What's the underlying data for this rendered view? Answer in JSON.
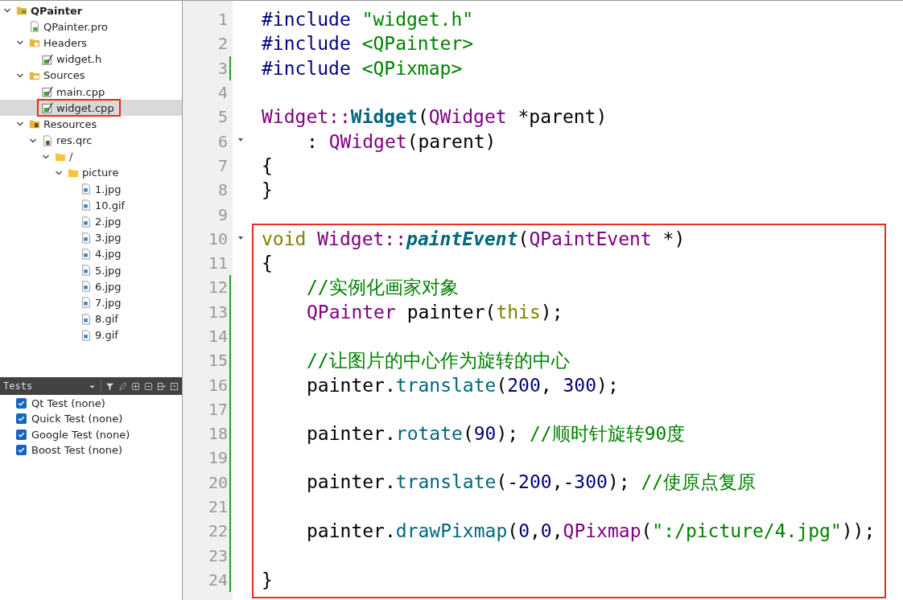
{
  "project_tree": [
    {
      "label": "QPainter",
      "kind": "project",
      "expanded": true,
      "selected": false,
      "boxed": false,
      "children": [
        {
          "label": "QPainter.pro",
          "kind": "pro",
          "selected": false,
          "boxed": false
        },
        {
          "label": "Headers",
          "kind": "headers",
          "expanded": true,
          "selected": false,
          "boxed": false,
          "children": [
            {
              "label": "widget.h",
              "kind": "source",
              "selected": false,
              "boxed": false
            }
          ]
        },
        {
          "label": "Sources",
          "kind": "sources",
          "expanded": true,
          "selected": false,
          "boxed": false,
          "children": [
            {
              "label": "main.cpp",
              "kind": "source",
              "selected": false,
              "boxed": false
            },
            {
              "label": "widget.cpp",
              "kind": "source",
              "selected": true,
              "boxed": true
            }
          ]
        },
        {
          "label": "Resources",
          "kind": "resources",
          "expanded": true,
          "selected": false,
          "boxed": false,
          "children": [
            {
              "label": "res.qrc",
              "kind": "qrc",
              "expanded": true,
              "selected": false,
              "boxed": false,
              "children": [
                {
                  "label": "/",
                  "kind": "folder",
                  "expanded": true,
                  "selected": false,
                  "boxed": false,
                  "children": [
                    {
                      "label": "picture",
                      "kind": "folder",
                      "expanded": true,
                      "selected": false,
                      "boxed": false,
                      "children": [
                        {
                          "label": "1.jpg",
                          "kind": "image",
                          "selected": false,
                          "boxed": false
                        },
                        {
                          "label": "10.gif",
                          "kind": "image",
                          "selected": false,
                          "boxed": false
                        },
                        {
                          "label": "2.jpg",
                          "kind": "image",
                          "selected": false,
                          "boxed": false
                        },
                        {
                          "label": "3.jpg",
                          "kind": "image",
                          "selected": false,
                          "boxed": false
                        },
                        {
                          "label": "4.jpg",
                          "kind": "image",
                          "selected": false,
                          "boxed": false
                        },
                        {
                          "label": "5.jpg",
                          "kind": "image",
                          "selected": false,
                          "boxed": false
                        },
                        {
                          "label": "6.jpg",
                          "kind": "image",
                          "selected": false,
                          "boxed": false
                        },
                        {
                          "label": "7.jpg",
                          "kind": "image",
                          "selected": false,
                          "boxed": false
                        },
                        {
                          "label": "8.gif",
                          "kind": "image",
                          "selected": false,
                          "boxed": false
                        },
                        {
                          "label": "9.gif",
                          "kind": "image",
                          "selected": false,
                          "boxed": false
                        }
                      ]
                    }
                  ]
                }
              ]
            }
          ]
        }
      ]
    }
  ],
  "tests_panel": {
    "title": "Tests",
    "items": [
      {
        "label": "Qt Test (none)",
        "checked": true
      },
      {
        "label": "Quick Test (none)",
        "checked": true
      },
      {
        "label": "Google Test (none)",
        "checked": true
      },
      {
        "label": "Boost Test (none)",
        "checked": true
      }
    ]
  },
  "editor": {
    "lines": [
      {
        "number": "1",
        "changed": false,
        "fold": false,
        "indented": false,
        "tokens": [
          {
            "text": "#include ",
            "kind": "preproc"
          },
          {
            "text": "\"widget.h\"",
            "kind": "string"
          }
        ]
      },
      {
        "number": "2",
        "changed": false,
        "fold": false,
        "indented": false,
        "tokens": [
          {
            "text": "#include ",
            "kind": "preproc"
          },
          {
            "text": "<QPainter>",
            "kind": "string"
          }
        ]
      },
      {
        "number": "3",
        "changed": true,
        "fold": false,
        "indented": false,
        "tokens": [
          {
            "text": "#include ",
            "kind": "preproc"
          },
          {
            "text": "<QPixmap>",
            "kind": "string"
          }
        ]
      },
      {
        "number": "4",
        "changed": false,
        "fold": false
      },
      {
        "number": "5",
        "changed": false,
        "fold": false,
        "indented": false,
        "tokens": [
          {
            "text": "Widget::",
            "kind": "type"
          },
          {
            "text": "Widget",
            "kind": "decl"
          },
          {
            "text": "(",
            "kind": "plain"
          },
          {
            "text": "QWidget",
            "kind": "type"
          },
          {
            "text": " *parent)",
            "kind": "plain"
          }
        ]
      },
      {
        "number": "6",
        "changed": false,
        "fold": true,
        "indented": true,
        "tokens": [
          {
            "text": ": ",
            "kind": "plain"
          },
          {
            "text": "QWidget",
            "kind": "type"
          },
          {
            "text": "(parent)",
            "kind": "plain"
          }
        ]
      },
      {
        "number": "7",
        "changed": false,
        "fold": false,
        "indented": false,
        "tokens": [
          {
            "text": "{",
            "kind": "plain"
          }
        ]
      },
      {
        "number": "8",
        "changed": false,
        "fold": false,
        "indented": false,
        "tokens": [
          {
            "text": "}",
            "kind": "plain"
          }
        ]
      },
      {
        "number": "9",
        "changed": false,
        "fold": false
      }
    ],
    "highlighted_block": {
      "lines": [
        {
          "number": "10",
          "changed": false,
          "fold": true,
          "indented": false,
          "tokens": [
            {
              "text": "void ",
              "kind": "keyword"
            },
            {
              "text": "Widget::",
              "kind": "type"
            },
            {
              "text": "paintEvent",
              "kind": "virtual"
            },
            {
              "text": "(",
              "kind": "plain"
            },
            {
              "text": "QPaintEvent",
              "kind": "type"
            },
            {
              "text": " *)",
              "kind": "plain"
            }
          ]
        },
        {
          "number": "11",
          "changed": false,
          "fold": false,
          "indented": false,
          "tokens": [
            {
              "text": "{",
              "kind": "plain"
            }
          ]
        },
        {
          "number": "12",
          "changed": true,
          "fold": false,
          "indented": true,
          "tokens": [
            {
              "text": "//实例化画家对象",
              "kind": "comment"
            }
          ]
        },
        {
          "number": "13",
          "changed": true,
          "fold": false,
          "indented": true,
          "tokens": [
            {
              "text": "QPainter",
              "kind": "type"
            },
            {
              "text": " painter(",
              "kind": "plain"
            },
            {
              "text": "this",
              "kind": "keyword"
            },
            {
              "text": ");",
              "kind": "plain"
            }
          ]
        },
        {
          "number": "14",
          "changed": true,
          "fold": false
        },
        {
          "number": "15",
          "changed": true,
          "fold": false,
          "indented": true,
          "tokens": [
            {
              "text": "//让图片的中心作为旋转的中心",
              "kind": "comment"
            }
          ]
        },
        {
          "number": "16",
          "changed": true,
          "fold": false,
          "indented": true,
          "tokens": [
            {
              "text": "painter.",
              "kind": "plain"
            },
            {
              "text": "translate",
              "kind": "func"
            },
            {
              "text": "(",
              "kind": "plain"
            },
            {
              "text": "200",
              "kind": "number"
            },
            {
              "text": ", ",
              "kind": "plain"
            },
            {
              "text": "300",
              "kind": "number"
            },
            {
              "text": ");",
              "kind": "plain"
            }
          ]
        },
        {
          "number": "17",
          "changed": true,
          "fold": false
        },
        {
          "number": "18",
          "changed": true,
          "fold": false,
          "indented": true,
          "tokens": [
            {
              "text": "painter.",
              "kind": "plain"
            },
            {
              "text": "rotate",
              "kind": "func"
            },
            {
              "text": "(",
              "kind": "plain"
            },
            {
              "text": "90",
              "kind": "number"
            },
            {
              "text": "); ",
              "kind": "plain"
            },
            {
              "text": "//顺时针旋转90度",
              "kind": "comment"
            }
          ]
        },
        {
          "number": "19",
          "changed": true,
          "fold": false
        },
        {
          "number": "20",
          "changed": true,
          "fold": false,
          "indented": true,
          "tokens": [
            {
              "text": "painter.",
              "kind": "plain"
            },
            {
              "text": "translate",
              "kind": "func"
            },
            {
              "text": "(-",
              "kind": "plain"
            },
            {
              "text": "200",
              "kind": "number"
            },
            {
              "text": ",-",
              "kind": "plain"
            },
            {
              "text": "300",
              "kind": "number"
            },
            {
              "text": "); ",
              "kind": "plain"
            },
            {
              "text": "//使原点复原",
              "kind": "comment"
            }
          ]
        },
        {
          "number": "21",
          "changed": true,
          "fold": false
        },
        {
          "number": "22",
          "changed": true,
          "fold": false,
          "indented": true,
          "tokens": [
            {
              "text": "painter.",
              "kind": "plain"
            },
            {
              "text": "drawPixmap",
              "kind": "func"
            },
            {
              "text": "(",
              "kind": "plain"
            },
            {
              "text": "0",
              "kind": "number"
            },
            {
              "text": ",",
              "kind": "plain"
            },
            {
              "text": "0",
              "kind": "number"
            },
            {
              "text": ",",
              "kind": "plain"
            },
            {
              "text": "QPixmap",
              "kind": "type"
            },
            {
              "text": "(",
              "kind": "plain"
            },
            {
              "text": "\":/picture/4.jpg\"",
              "kind": "string"
            },
            {
              "text": "));",
              "kind": "plain"
            }
          ]
        },
        {
          "number": "23",
          "changed": true,
          "fold": false
        },
        {
          "number": "24",
          "changed": true,
          "fold": false,
          "indented": false,
          "tokens": [
            {
              "text": "}",
              "kind": "plain"
            }
          ]
        }
      ]
    }
  }
}
